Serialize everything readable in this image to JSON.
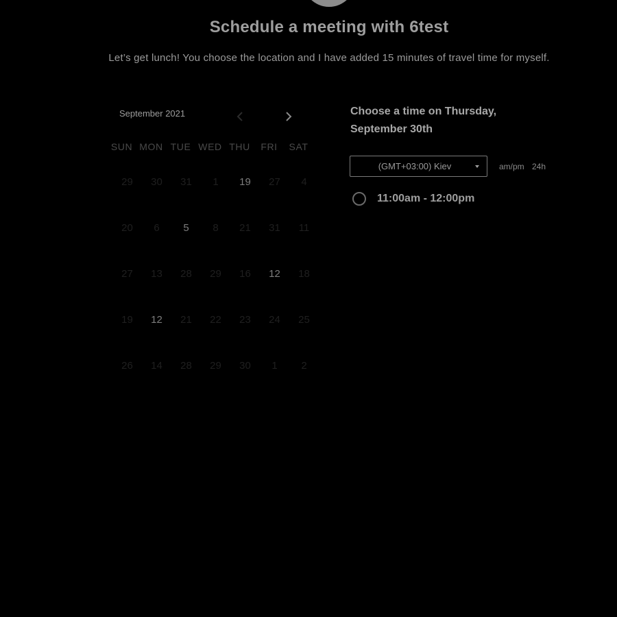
{
  "header": {
    "title": "Schedule a meeting with 6test",
    "subtitle": "Let’s get lunch! You choose the location and I have added 15 minutes of travel time for myself."
  },
  "calendar": {
    "month_label": "September 2021",
    "prev_icon": "chevron-left-icon",
    "next_icon": "chevron-right-icon",
    "weekdays": [
      "SUN",
      "MON",
      "TUE",
      "WED",
      "THU",
      "FRI",
      "SAT"
    ],
    "weeks": [
      [
        {
          "label": "29",
          "available": false
        },
        {
          "label": "30",
          "available": false
        },
        {
          "label": "31",
          "available": false
        },
        {
          "label": "1",
          "available": false
        },
        {
          "label": "19",
          "available": true
        },
        {
          "label": "27",
          "available": false
        },
        {
          "label": "4",
          "available": false
        }
      ],
      [
        {
          "label": "20",
          "available": false
        },
        {
          "label": "6",
          "available": false
        },
        {
          "label": "5",
          "available": true
        },
        {
          "label": "8",
          "available": false
        },
        {
          "label": "21",
          "available": false
        },
        {
          "label": "31",
          "available": false
        },
        {
          "label": "11",
          "available": false
        }
      ],
      [
        {
          "label": "27",
          "available": false
        },
        {
          "label": "13",
          "available": false
        },
        {
          "label": "28",
          "available": false
        },
        {
          "label": "29",
          "available": false
        },
        {
          "label": "16",
          "available": false
        },
        {
          "label": "12",
          "available": true
        },
        {
          "label": "18",
          "available": false
        }
      ],
      [
        {
          "label": "19",
          "available": false
        },
        {
          "label": "12",
          "available": true
        },
        {
          "label": "21",
          "available": false
        },
        {
          "label": "22",
          "available": false
        },
        {
          "label": "23",
          "available": false
        },
        {
          "label": "24",
          "available": false
        },
        {
          "label": "25",
          "available": false
        }
      ],
      [
        {
          "label": "26",
          "available": false
        },
        {
          "label": "14",
          "available": false
        },
        {
          "label": "28",
          "available": false
        },
        {
          "label": "29",
          "available": false
        },
        {
          "label": "30",
          "available": false
        },
        {
          "label": "1",
          "available": false
        },
        {
          "label": "2",
          "available": false
        }
      ]
    ]
  },
  "times": {
    "heading": "Choose a time on Thursday, September 30th",
    "timezone": "(GMT+03:00) Kiev",
    "format_12h": "am/pm",
    "format_24h": "24h",
    "slots": [
      "11:00am - 12:00pm"
    ]
  },
  "colors": {
    "background": "#000000",
    "text_primary": "#a8a8a8",
    "text_muted": "#4a4a4a"
  }
}
